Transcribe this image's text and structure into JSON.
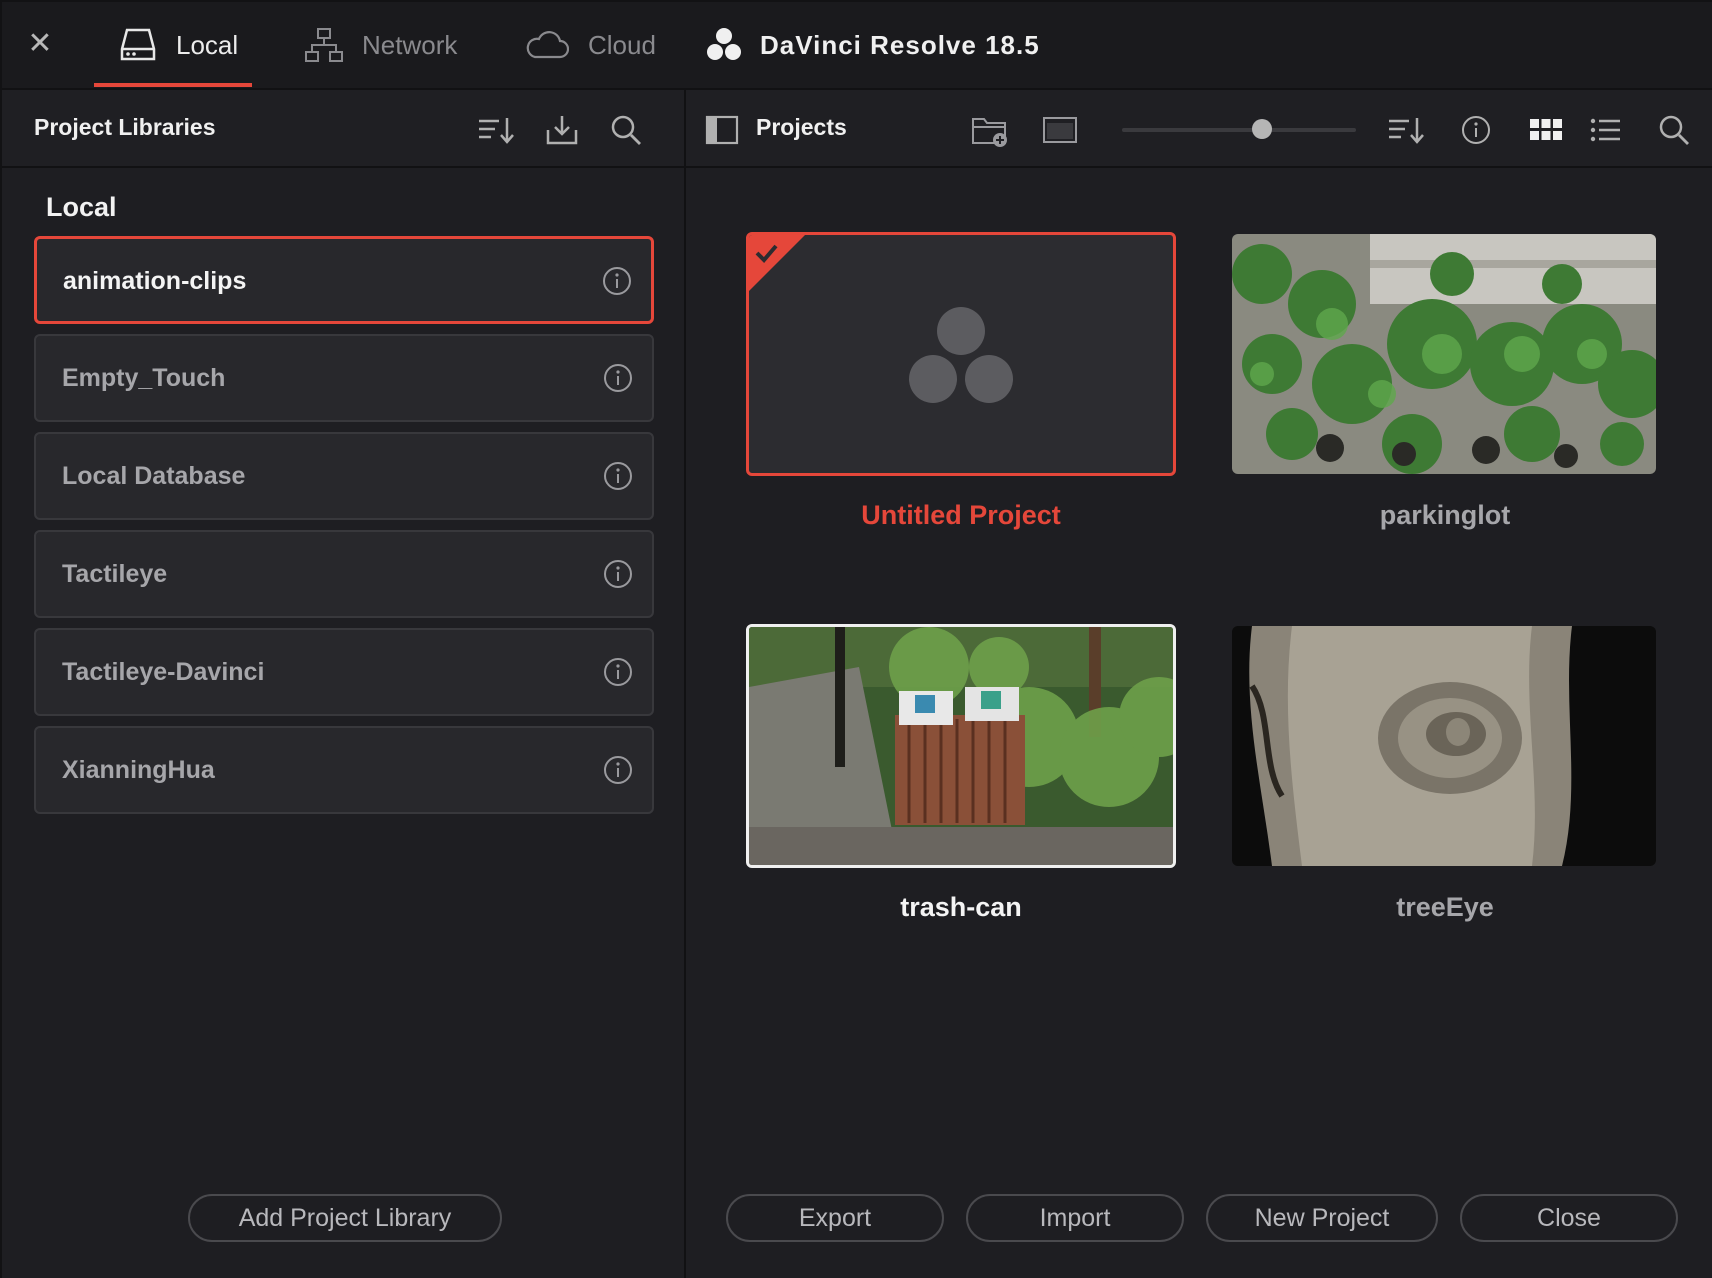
{
  "tabs": [
    {
      "label": "Local",
      "active": true,
      "icon": "hard-drive-icon"
    },
    {
      "label": "Network",
      "active": false,
      "icon": "network-icon"
    },
    {
      "label": "Cloud",
      "active": false,
      "icon": "cloud-icon"
    }
  ],
  "app_title": "DaVinci Resolve 18.5",
  "left_panel": {
    "title": "Project Libraries",
    "section": "Local",
    "libraries": [
      {
        "name": "animation-clips",
        "selected": true
      },
      {
        "name": "Empty_Touch",
        "selected": false
      },
      {
        "name": "Local Database",
        "selected": false
      },
      {
        "name": "Tactileye",
        "selected": false
      },
      {
        "name": "Tactileye-Davinci",
        "selected": false
      },
      {
        "name": "XianningHua",
        "selected": false
      }
    ],
    "add_button": "Add Project Library"
  },
  "right_panel": {
    "title": "Projects",
    "zoom_slider": 0.6,
    "projects": [
      {
        "name": "Untitled Project",
        "selected": true,
        "thumbnail": "resolve-logo-placeholder"
      },
      {
        "name": "parkinglot",
        "selected": false,
        "thumbnail": "grass-pavers-photo"
      },
      {
        "name": "trash-can",
        "selected": false,
        "thumbnail": "trash-can-photo"
      },
      {
        "name": "treeEye",
        "selected": false,
        "thumbnail": "tree-bark-photo"
      }
    ],
    "buttons": {
      "export": "Export",
      "import": "Import",
      "new_project": "New Project",
      "close": "Close"
    }
  },
  "colors": {
    "accent": "#e5473a",
    "background": "#1e1e22",
    "panel": "#28282c"
  }
}
